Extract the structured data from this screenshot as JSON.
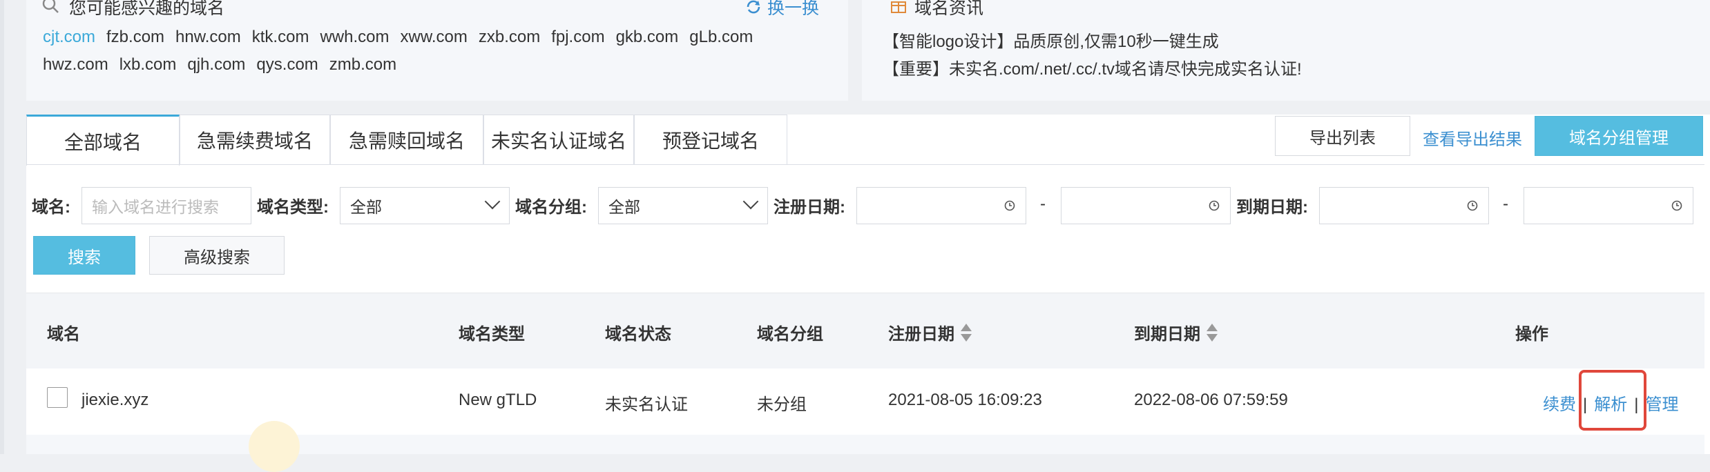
{
  "suggest": {
    "title": "您可能感兴趣的域名",
    "refresh_label": "换一换",
    "row1": [
      "cjt.com",
      "fzb.com",
      "hnw.com",
      "ktk.com",
      "wwh.com",
      "xww.com",
      "zxb.com",
      "fpj.com",
      "gkb.com",
      "gLb.com"
    ],
    "row2": [
      "hwz.com",
      "lxb.com",
      "qjh.com",
      "qys.com",
      "zmb.com"
    ]
  },
  "news": {
    "title": "域名资讯",
    "lines": [
      "【智能logo设计】品质原创,仅需10秒一键生成",
      "【重要】未实名.com/.net/.cc/.tv域名请尽快完成实名认证!"
    ]
  },
  "tabs": [
    "全部域名",
    "急需续费域名",
    "急需赎回域名",
    "未实名认证域名",
    "预登记域名"
  ],
  "toolbar": {
    "export_label": "导出列表",
    "view_export_label": "查看导出结果",
    "group_manage_label": "域名分组管理"
  },
  "filters": {
    "domain_label": "域名:",
    "domain_placeholder": "输入域名进行搜索",
    "type_label": "域名类型:",
    "type_value": "全部",
    "group_label": "域名分组:",
    "group_value": "全部",
    "reg_date_label": "注册日期:",
    "expire_date_label": "到期日期:",
    "dash": "-",
    "search_label": "搜索",
    "advanced_label": "高级搜索"
  },
  "table": {
    "headers": [
      "域名",
      "域名类型",
      "域名状态",
      "域名分组",
      "注册日期",
      "到期日期",
      "操作"
    ],
    "rows": [
      {
        "domain": "jiexie.xyz",
        "type": "New gTLD",
        "status": "未实名认证",
        "group": "未分组",
        "reg_date": "2021-08-05 16:09:23",
        "expire_date": "2022-08-06 07:59:59",
        "actions": [
          "续费",
          "解析",
          "管理"
        ],
        "separator": "|"
      }
    ]
  },
  "colors": {
    "accent": "#55bde0",
    "link": "#3b8fd0",
    "highlight": "#e0473b"
  }
}
